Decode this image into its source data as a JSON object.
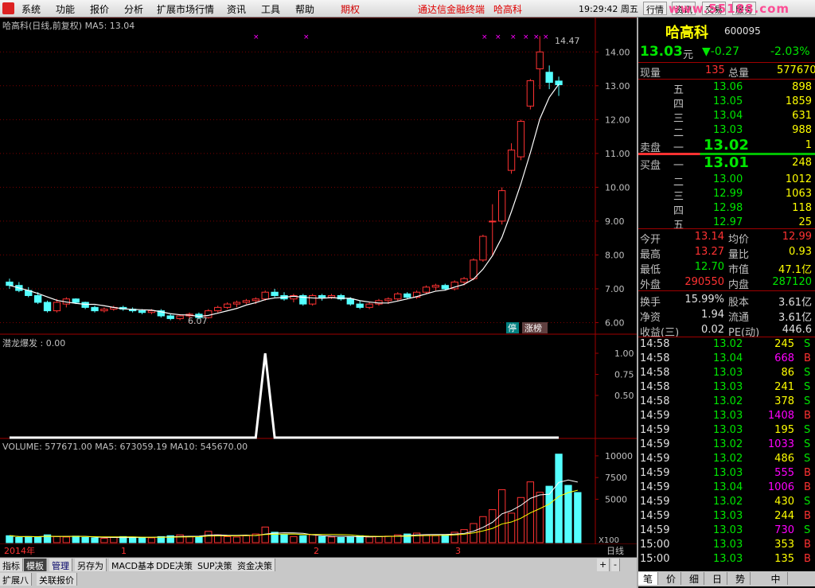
{
  "menubar": {
    "items": [
      "系统",
      "功能",
      "报价",
      "分析",
      "扩展市场行情",
      "资讯",
      "工具",
      "帮助"
    ],
    "quanqi": "期权",
    "ad": "通达信金融终端",
    "stock_ad": "哈高科",
    "clock": "19:29:42 周五",
    "tabs": [
      "行情",
      "资讯",
      "交易",
      "服务"
    ],
    "watermark": "www.55188.com"
  },
  "chart": {
    "title": "哈高科(日线,前复权) MA5: 13.04",
    "high_label": "14.47",
    "low_label": "6.07",
    "price_ticks": [
      "14.00",
      "13.00",
      "12.00",
      "11.00",
      "10.00",
      "9.00",
      "8.00",
      "7.00",
      "6.00"
    ],
    "tags": {
      "ting": "停",
      "zhangbang": "涨榜"
    },
    "indicator": {
      "title": "潜龙爆发 : 0.00",
      "ticks": [
        "1.00",
        "0.75",
        "0.50"
      ]
    },
    "volume": {
      "title": "VOLUME: 577671.00  MA5: 673059.19  MA10: 545670.00",
      "ticks": [
        "10000",
        "7500",
        "5000"
      ],
      "unit": "X100"
    },
    "date_labels": [
      "2014年",
      "1",
      "2",
      "3"
    ],
    "period": "日线",
    "candles": [
      {
        "o": 7.2,
        "h": 7.3,
        "l": 7.0,
        "c": 7.1
      },
      {
        "o": 7.1,
        "h": 7.2,
        "l": 6.9,
        "c": 6.95
      },
      {
        "o": 6.95,
        "h": 7.05,
        "l": 6.75,
        "c": 6.8
      },
      {
        "o": 6.8,
        "h": 6.9,
        "l": 6.55,
        "c": 6.6
      },
      {
        "o": 6.6,
        "h": 6.65,
        "l": 6.3,
        "c": 6.35
      },
      {
        "o": 6.35,
        "h": 6.7,
        "l": 6.3,
        "c": 6.6
      },
      {
        "o": 6.55,
        "h": 6.75,
        "l": 6.45,
        "c": 6.7
      },
      {
        "o": 6.7,
        "h": 6.72,
        "l": 6.55,
        "c": 6.6
      },
      {
        "o": 6.6,
        "h": 6.62,
        "l": 6.4,
        "c": 6.45
      },
      {
        "o": 6.45,
        "h": 6.5,
        "l": 6.3,
        "c": 6.35
      },
      {
        "o": 6.35,
        "h": 6.45,
        "l": 6.3,
        "c": 6.4
      },
      {
        "o": 6.4,
        "h": 6.5,
        "l": 6.35,
        "c": 6.45
      },
      {
        "o": 6.45,
        "h": 6.5,
        "l": 6.35,
        "c": 6.4
      },
      {
        "o": 6.4,
        "h": 6.45,
        "l": 6.3,
        "c": 6.35
      },
      {
        "o": 6.35,
        "h": 6.4,
        "l": 6.25,
        "c": 6.3
      },
      {
        "o": 6.3,
        "h": 6.4,
        "l": 6.25,
        "c": 6.35
      },
      {
        "o": 6.35,
        "h": 6.4,
        "l": 6.15,
        "c": 6.2
      },
      {
        "o": 6.2,
        "h": 6.25,
        "l": 6.07,
        "c": 6.12
      },
      {
        "o": 6.12,
        "h": 6.25,
        "l": 6.07,
        "c": 6.2
      },
      {
        "o": 6.2,
        "h": 6.3,
        "l": 6.1,
        "c": 6.25
      },
      {
        "o": 6.25,
        "h": 6.3,
        "l": 6.1,
        "c": 6.15
      },
      {
        "o": 6.15,
        "h": 6.4,
        "l": 6.12,
        "c": 6.35
      },
      {
        "o": 6.35,
        "h": 6.5,
        "l": 6.3,
        "c": 6.45
      },
      {
        "o": 6.45,
        "h": 6.6,
        "l": 6.4,
        "c": 6.55
      },
      {
        "o": 6.55,
        "h": 6.65,
        "l": 6.45,
        "c": 6.6
      },
      {
        "o": 6.6,
        "h": 6.7,
        "l": 6.55,
        "c": 6.65
      },
      {
        "o": 6.65,
        "h": 6.75,
        "l": 6.55,
        "c": 6.7
      },
      {
        "o": 6.7,
        "h": 6.95,
        "l": 6.65,
        "c": 6.9
      },
      {
        "o": 6.9,
        "h": 7.0,
        "l": 6.75,
        "c": 6.8
      },
      {
        "o": 6.8,
        "h": 6.9,
        "l": 6.65,
        "c": 6.7
      },
      {
        "o": 6.7,
        "h": 6.85,
        "l": 6.6,
        "c": 6.8
      },
      {
        "o": 6.8,
        "h": 6.85,
        "l": 6.5,
        "c": 6.55
      },
      {
        "o": 6.55,
        "h": 6.85,
        "l": 6.5,
        "c": 6.8
      },
      {
        "o": 6.8,
        "h": 6.85,
        "l": 6.65,
        "c": 6.75
      },
      {
        "o": 6.75,
        "h": 6.85,
        "l": 6.7,
        "c": 6.8
      },
      {
        "o": 6.8,
        "h": 6.85,
        "l": 6.65,
        "c": 6.7
      },
      {
        "o": 6.7,
        "h": 6.75,
        "l": 6.5,
        "c": 6.55
      },
      {
        "o": 6.55,
        "h": 6.65,
        "l": 6.4,
        "c": 6.45
      },
      {
        "o": 6.45,
        "h": 6.6,
        "l": 6.4,
        "c": 6.55
      },
      {
        "o": 6.55,
        "h": 6.7,
        "l": 6.5,
        "c": 6.65
      },
      {
        "o": 6.65,
        "h": 6.75,
        "l": 6.55,
        "c": 6.7
      },
      {
        "o": 6.7,
        "h": 6.9,
        "l": 6.65,
        "c": 6.85
      },
      {
        "o": 6.85,
        "h": 6.9,
        "l": 6.7,
        "c": 6.75
      },
      {
        "o": 6.75,
        "h": 6.95,
        "l": 6.7,
        "c": 6.9
      },
      {
        "o": 6.9,
        "h": 7.1,
        "l": 6.85,
        "c": 7.05
      },
      {
        "o": 7.05,
        "h": 7.15,
        "l": 6.95,
        "c": 7.1
      },
      {
        "o": 7.1,
        "h": 7.15,
        "l": 6.95,
        "c": 7.0
      },
      {
        "o": 7.0,
        "h": 7.25,
        "l": 6.95,
        "c": 7.2
      },
      {
        "o": 7.2,
        "h": 7.35,
        "l": 7.1,
        "c": 7.3
      },
      {
        "o": 7.3,
        "h": 7.9,
        "l": 7.25,
        "c": 7.85
      },
      {
        "o": 7.85,
        "h": 8.6,
        "l": 7.8,
        "c": 8.55
      },
      {
        "o": 9.0,
        "h": 9.5,
        "l": 8.0,
        "c": 9.0
      },
      {
        "o": 9.0,
        "h": 10.0,
        "l": 8.9,
        "c": 9.9
      },
      {
        "o": 10.5,
        "h": 11.3,
        "l": 10.4,
        "c": 11.1
      },
      {
        "o": 10.9,
        "h": 12.0,
        "l": 10.8,
        "c": 11.95
      },
      {
        "o": 12.4,
        "h": 13.2,
        "l": 12.3,
        "c": 13.15
      },
      {
        "o": 13.5,
        "h": 14.47,
        "l": 12.9,
        "c": 14.0
      },
      {
        "o": 13.4,
        "h": 13.6,
        "l": 12.9,
        "c": 13.1
      },
      {
        "o": 13.14,
        "h": 13.27,
        "l": 12.7,
        "c": 13.03
      }
    ],
    "indicator_series": [
      0,
      0,
      0,
      0,
      0,
      0,
      0,
      0,
      0,
      0,
      0,
      0,
      0,
      0,
      0,
      0,
      0,
      0,
      0,
      0,
      0,
      0,
      0,
      0,
      0,
      0,
      0,
      1,
      0,
      0,
      0,
      0,
      0,
      0,
      0,
      0,
      0,
      0,
      0,
      0,
      0,
      0,
      0,
      0,
      0,
      0,
      0,
      0,
      0,
      0,
      0,
      0,
      0,
      0,
      0,
      0,
      0,
      0,
      0
    ],
    "volumes": [
      800,
      600,
      700,
      650,
      900,
      700,
      650,
      750,
      600,
      550,
      500,
      600,
      700,
      650,
      600,
      550,
      700,
      800,
      900,
      700,
      650,
      1300,
      900,
      700,
      650,
      800,
      1000,
      1800,
      1200,
      900,
      700,
      800,
      900,
      700,
      650,
      600,
      700,
      800,
      650,
      700,
      750,
      900,
      1000,
      1100,
      900,
      800,
      900,
      1200,
      1500,
      2200,
      3000,
      3800,
      6100,
      3400,
      5200,
      7000,
      5800,
      6500,
      10200,
      6600,
      5776
    ]
  },
  "quote": {
    "name": "哈高科",
    "code": "600095",
    "price": "13.03",
    "unit": "元",
    "change": "▼-0.27",
    "pct": "-2.03%",
    "xianliang_label": "现量",
    "xianliang": "135",
    "zongliang_label": "总量",
    "zongliang": "577670",
    "asks": [
      {
        "n": "五",
        "p": "13.06",
        "v": "898"
      },
      {
        "n": "四",
        "p": "13.05",
        "v": "1859"
      },
      {
        "n": "三",
        "p": "13.04",
        "v": "631"
      },
      {
        "n": "二",
        "p": "13.03",
        "v": "988"
      }
    ],
    "ask1": {
      "label": "卖盘",
      "n": "一",
      "p": "13.02",
      "v": "1"
    },
    "bid1": {
      "label": "买盘",
      "n": "一",
      "p": "13.01",
      "v": "248"
    },
    "bids": [
      {
        "n": "二",
        "p": "13.00",
        "v": "1012"
      },
      {
        "n": "三",
        "p": "12.99",
        "v": "1063"
      },
      {
        "n": "四",
        "p": "12.98",
        "v": "118"
      },
      {
        "n": "五",
        "p": "12.97",
        "v": "25"
      }
    ],
    "stats": [
      {
        "a": "今开",
        "av": "13.14",
        "b": "均价",
        "bv": "12.99"
      },
      {
        "a": "最高",
        "av": "13.27",
        "b": "量比",
        "bv": "0.93"
      },
      {
        "a": "最低",
        "av": "12.70",
        "b": "市值",
        "bv": "47.1亿"
      },
      {
        "a": "外盘",
        "av": "290550",
        "b": "内盘",
        "bv": "287120"
      },
      {
        "a": "换手",
        "av": "15.99%",
        "b": "股本",
        "bv": "3.61亿"
      },
      {
        "a": "净资",
        "av": "1.94",
        "b": "流通",
        "bv": "3.61亿"
      },
      {
        "a": "收益(三)",
        "av": "0.02",
        "b": "PE(动)",
        "bv": "446.6"
      }
    ],
    "ticks": [
      {
        "t": "14:58",
        "p": "13.02",
        "v": "245",
        "s": "S"
      },
      {
        "t": "14:58",
        "p": "13.04",
        "v": "668",
        "s": "B"
      },
      {
        "t": "14:58",
        "p": "13.03",
        "v": "86",
        "s": "S"
      },
      {
        "t": "14:58",
        "p": "13.03",
        "v": "241",
        "s": "S"
      },
      {
        "t": "14:58",
        "p": "13.02",
        "v": "378",
        "s": "S"
      },
      {
        "t": "14:59",
        "p": "13.03",
        "v": "1408",
        "s": "B"
      },
      {
        "t": "14:59",
        "p": "13.03",
        "v": "195",
        "s": "S"
      },
      {
        "t": "14:59",
        "p": "13.02",
        "v": "1033",
        "s": "S"
      },
      {
        "t": "14:59",
        "p": "13.02",
        "v": "486",
        "s": "S"
      },
      {
        "t": "14:59",
        "p": "13.03",
        "v": "555",
        "s": "B"
      },
      {
        "t": "14:59",
        "p": "13.04",
        "v": "1006",
        "s": "B"
      },
      {
        "t": "14:59",
        "p": "13.02",
        "v": "430",
        "s": "S"
      },
      {
        "t": "14:59",
        "p": "13.03",
        "v": "244",
        "s": "B"
      },
      {
        "t": "14:59",
        "p": "13.03",
        "v": "730",
        "s": "S"
      },
      {
        "t": "15:00",
        "p": "13.03",
        "v": "353",
        "s": "B"
      },
      {
        "t": "15:00",
        "p": "13.03",
        "v": "135",
        "s": "B"
      }
    ],
    "tabs": [
      "笔",
      "价",
      "细",
      "日",
      "势"
    ],
    "ime": "中"
  },
  "bottom": {
    "tabs": [
      "指标",
      "模板",
      "管理",
      "另存为",
      "MACD基本",
      "DDE决策",
      "SUP决策",
      "资金决策"
    ],
    "tabs2": [
      "扩展八",
      "关联报价"
    ],
    "plus": "+",
    "minus": "-"
  },
  "colors": {
    "up": "#ff3232",
    "down": "#54ffff",
    "ma5": "#ffffff",
    "grid": "#a00000",
    "vol_ma5": "#ffffff",
    "vol_ma10": "#ffff00"
  }
}
